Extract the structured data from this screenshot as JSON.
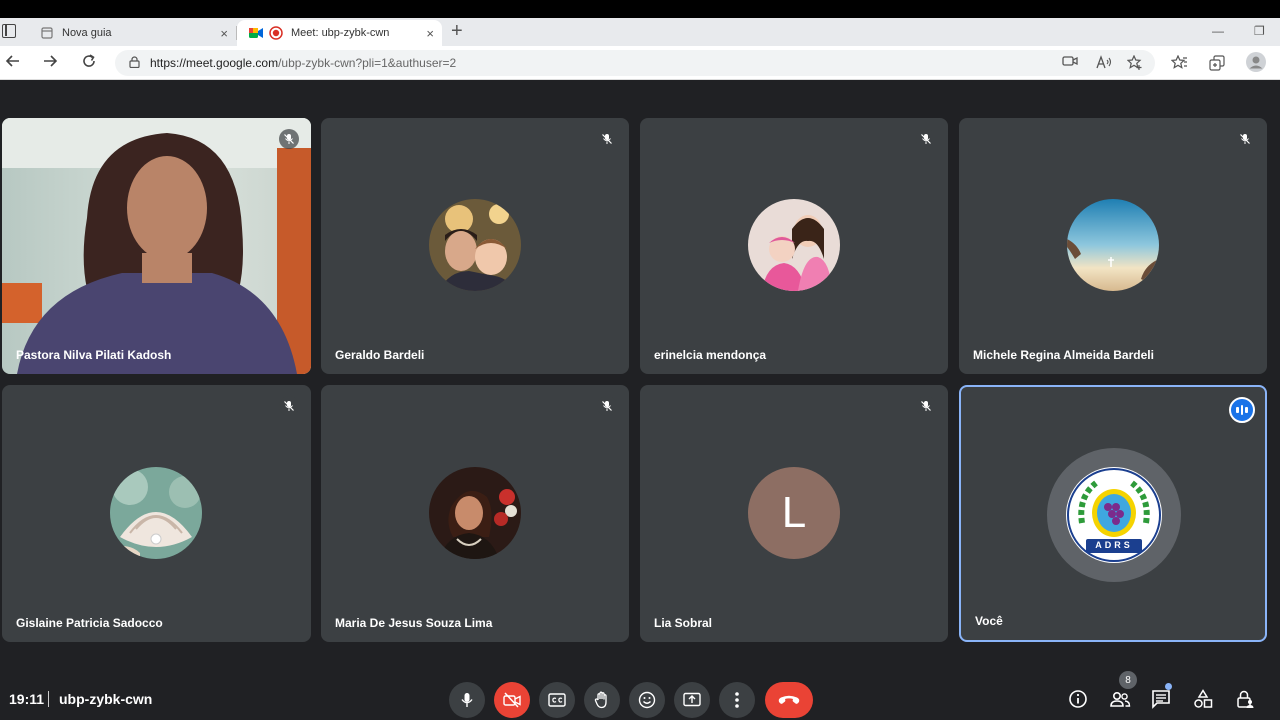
{
  "browser": {
    "tabs": [
      {
        "title": "Nova guia",
        "close": "×"
      },
      {
        "title": "Meet: ubp-zybk-cwn",
        "close": "×"
      }
    ],
    "new_tab": "+",
    "minimize": "—",
    "restore": "❐",
    "url_host": "https://meet.google.com",
    "url_path": "/ubp-zybk-cwn?pli=1&authuser=2"
  },
  "participants": [
    {
      "name": "Pastora Nilva Pilati Kadosh",
      "muted": true,
      "video": true
    },
    {
      "name": "Geraldo Bardeli",
      "muted": true
    },
    {
      "name": "erinelcia mendonça",
      "muted": true
    },
    {
      "name": "Michele Regina Almeida Bardeli",
      "muted": true
    },
    {
      "name": "Gislaine Patricia Sadocco",
      "muted": true
    },
    {
      "name": "Maria De Jesus Souza Lima",
      "muted": true
    },
    {
      "name": "Lia Sobral",
      "muted": true,
      "initial": "L"
    },
    {
      "name": "Você",
      "speaking": true,
      "logo_text": "ADRS"
    }
  ],
  "footer": {
    "time": "19:11",
    "meeting_code": "ubp-zybk-cwn",
    "people_count": "8"
  },
  "colors": {
    "background": "#202124",
    "tile": "#3c4043",
    "accent": "#1a73e8",
    "danger": "#ea4335",
    "avatar_lia": "#8d6e63"
  }
}
